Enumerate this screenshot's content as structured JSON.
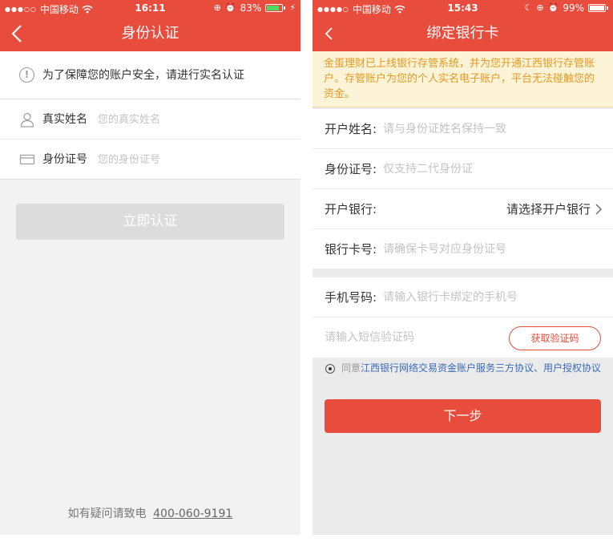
{
  "left": {
    "status": {
      "carrier": "中国移动",
      "time": "16:11",
      "battery": "83%",
      "battery_fill": 0.83
    },
    "nav": {
      "title": "身份认证"
    },
    "notice": "为了保障您的账户安全，请进行实名认证",
    "form": {
      "name_label": "真实姓名",
      "name_placeholder": "您的真实姓名",
      "id_label": "身份证号",
      "id_placeholder": "您的身份证号"
    },
    "submit_label": "立即认证",
    "footer": {
      "prefix": "如有疑问请致电",
      "phone": "400-060-9191"
    }
  },
  "right": {
    "status": {
      "carrier": "中国移动",
      "time": "15:43",
      "battery": "99%",
      "battery_fill": 0.99
    },
    "nav": {
      "title": "绑定银行卡"
    },
    "banner": "金蛋理财已上线银行存管系统，并为您开通江西银行存管账户。存管账户为您的个人实名电子账户，平台无法碰触您的资金。",
    "form": {
      "holder_label": "开户姓名:",
      "holder_placeholder": "请与身份证姓名保持一致",
      "id_label": "身份证号:",
      "id_placeholder": "仅支持二代身份证",
      "bank_label": "开户银行:",
      "bank_select": "请选择开户银行",
      "card_label": "银行卡号:",
      "card_placeholder": "请确保卡号对应身份证号",
      "phone_label": "手机号码:",
      "phone_placeholder": "请输入银行卡绑定的手机号",
      "sms_placeholder": "请输入短信验证码",
      "sms_button": "获取验证码"
    },
    "agree": {
      "prefix": "同意",
      "link": "江西银行网络交易资金账户服务三方协议、用户授权协议"
    },
    "next_label": "下一步"
  },
  "colors": {
    "brand": "#e84c3d",
    "battery_left": "#4cd964",
    "battery_right": "#ffffff",
    "link": "#3b6bb6",
    "banner_text": "#e49a24"
  }
}
